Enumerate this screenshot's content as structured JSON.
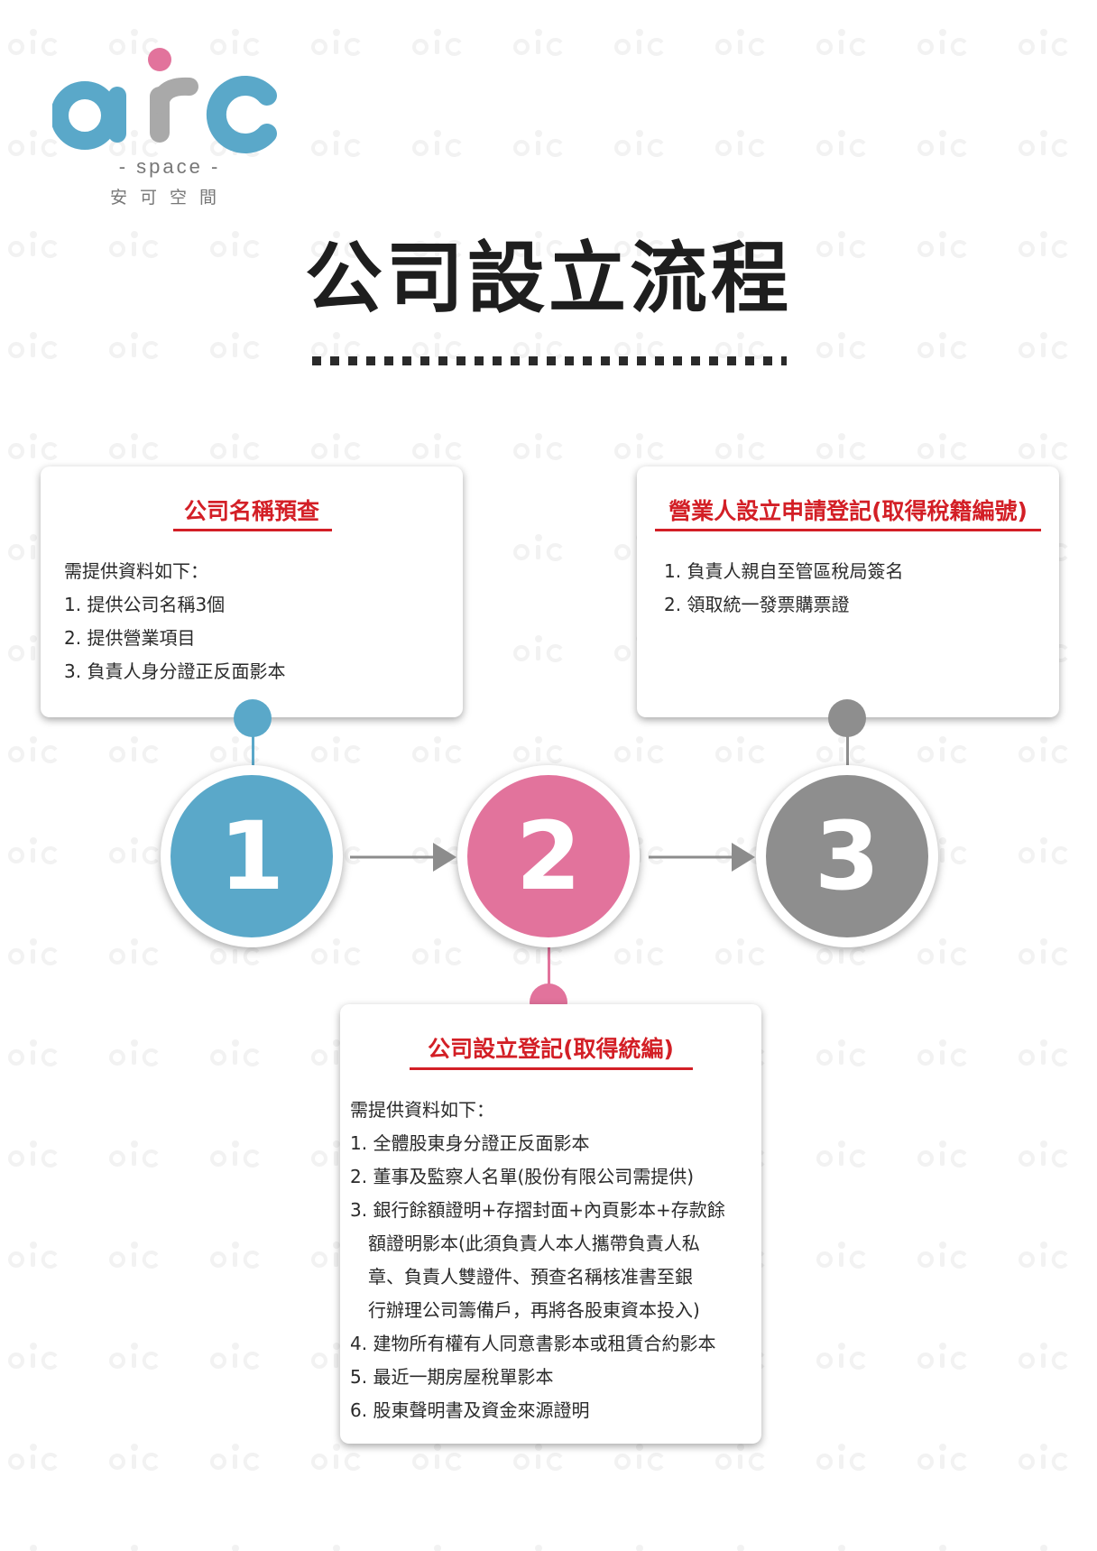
{
  "colors": {
    "blue": "#5aa8c9",
    "pink": "#e2739c",
    "gray": "#8e8e8e",
    "red": "#d31f26",
    "logo_gray": "#a9a9a9"
  },
  "logo": {
    "letters": "arc",
    "sub": "- space -",
    "chinese": "安可空間"
  },
  "title": "公司設立流程",
  "steps": [
    {
      "number": "1",
      "color": "#5aa8c9"
    },
    {
      "number": "2",
      "color": "#e2739c"
    },
    {
      "number": "3",
      "color": "#8e8e8e"
    }
  ],
  "cards": {
    "step1": {
      "title": "公司名稱預查",
      "items": [
        "需提供資料如下：",
        "1. 提供公司名稱3個",
        "2. 提供營業項目",
        "3. 負責人身分證正反面影本"
      ]
    },
    "step3": {
      "title": "營業人設立申請登記(取得稅籍編號)",
      "items": [
        "1. 負責人親自至管區稅局簽名",
        "2. 領取統一發票購票證"
      ]
    },
    "step2": {
      "title": "公司設立登記(取得統編)",
      "items": [
        "需提供資料如下：",
        "1. 全體股東身分證正反面影本",
        "2. 董事及監察人名單(股份有限公司需提供)",
        "3. 銀行餘額證明+存摺封面+內頁影本+存款餘",
        "額證明影本(此須負責人本人攜帶負責人私",
        "章、負責人雙證件、預查名稱核准書至銀",
        "行辦理公司籌備戶，再將各股東資本投入)",
        "4. 建物所有權有人同意書影本或租賃合約影本",
        "5. 最近一期房屋稅單影本",
        "6. 股東聲明書及資金來源證明"
      ]
    }
  }
}
